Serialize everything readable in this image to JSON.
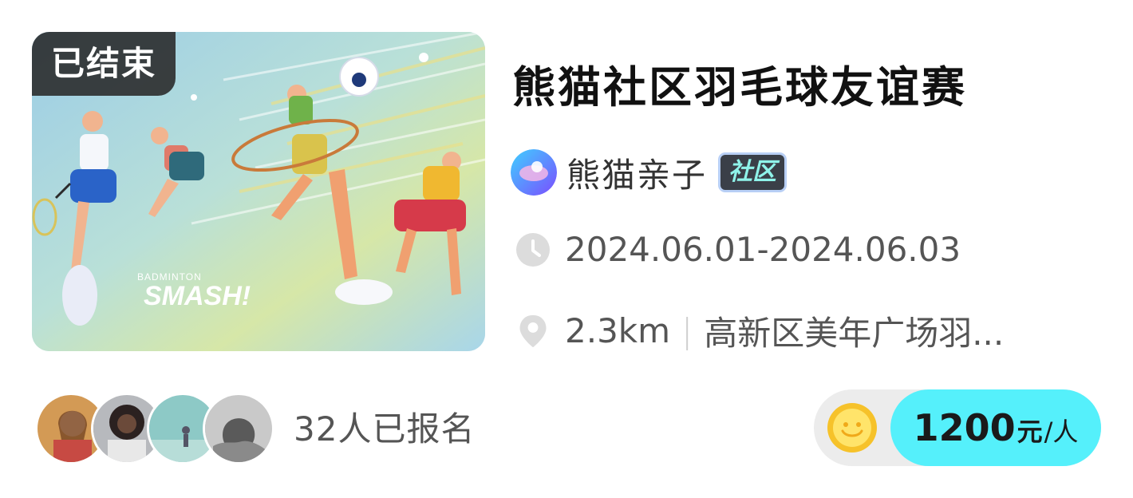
{
  "event": {
    "status": "已结束",
    "title": "熊猫社区羽毛球友谊赛",
    "organizer": {
      "name": "熊猫亲子",
      "tag": "社区"
    },
    "date_range": "2024.06.01-2024.06.03",
    "distance": "2.3km",
    "location": "高新区美年广场羽...",
    "cover": {
      "text_small": "BADMINTON",
      "text_big": "SMASH!"
    }
  },
  "participants": {
    "enrolled_text": "32人已报名",
    "avatar_count": 4
  },
  "price": {
    "amount": "1200",
    "currency": "元",
    "per": "/人"
  },
  "icons": {
    "clock": "clock-icon",
    "location": "location-pin-icon",
    "coin": "coin-icon"
  },
  "colors": {
    "accent": "#55f0fb",
    "status_badge": "#282828",
    "tag_bg": "#3a3f48",
    "tag_text": "#8ff3ea"
  }
}
